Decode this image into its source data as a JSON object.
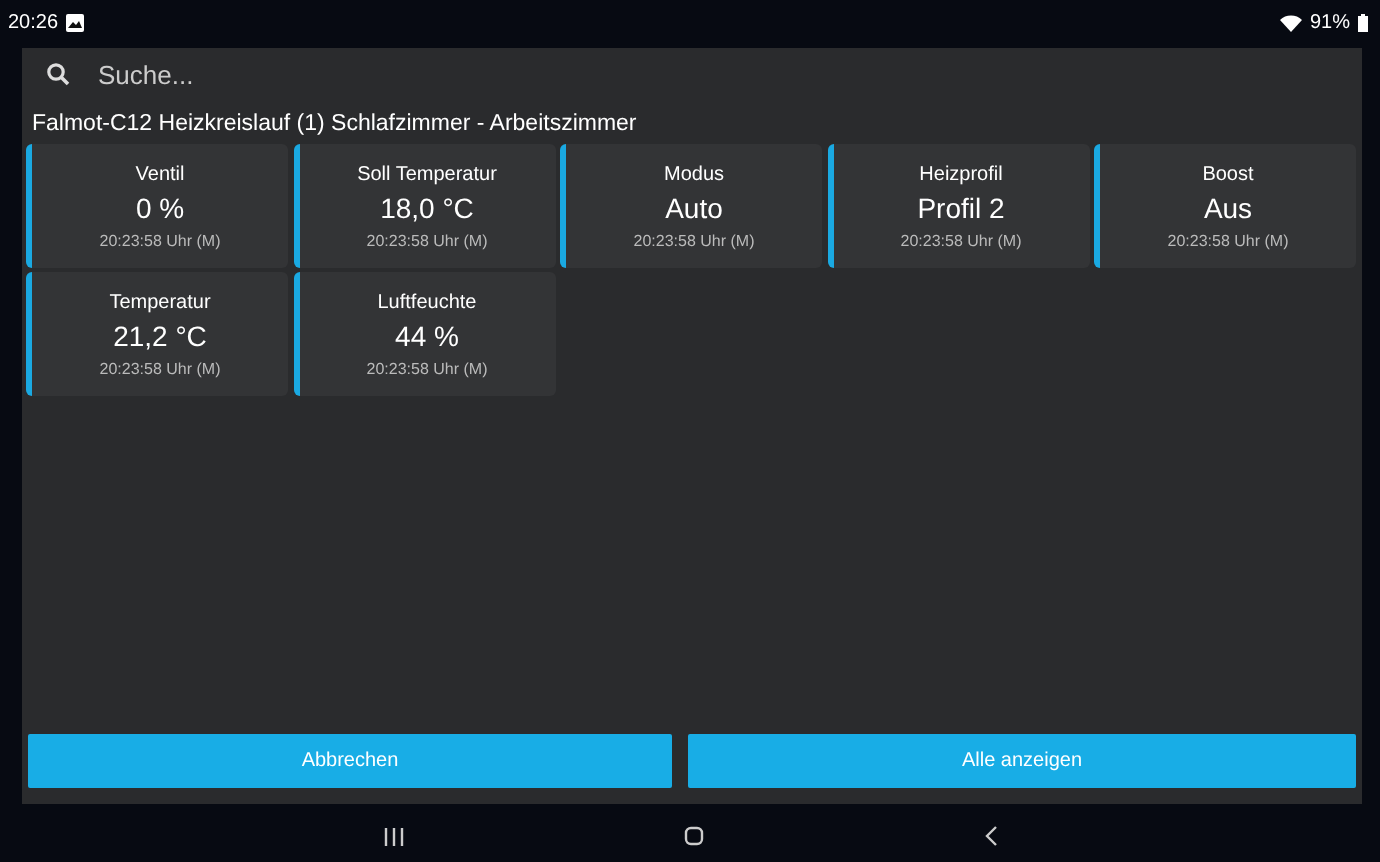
{
  "status_bar": {
    "time": "20:26",
    "battery": "91%"
  },
  "search": {
    "placeholder": "Suche..."
  },
  "dialog": {
    "title": "Falmot-C12 Heizkreislauf (1) Schlafzimmer - Arbeitszimmer",
    "tiles": [
      {
        "label": "Ventil",
        "value": "0 %",
        "time": "20:23:58 Uhr (M)"
      },
      {
        "label": "Soll Temperatur",
        "value": "18,0 °C",
        "time": "20:23:58 Uhr (M)"
      },
      {
        "label": "Modus",
        "value": "Auto",
        "time": "20:23:58 Uhr (M)"
      },
      {
        "label": "Heizprofil",
        "value": "Profil 2",
        "time": "20:23:58 Uhr (M)"
      },
      {
        "label": "Boost",
        "value": "Aus",
        "time": "20:23:58 Uhr (M)"
      },
      {
        "label": "Temperatur",
        "value": "21,2 °C",
        "time": "20:23:58 Uhr (M)"
      },
      {
        "label": "Luftfeuchte",
        "value": "44 %",
        "time": "20:23:58 Uhr (M)"
      }
    ],
    "buttons": [
      "Abbrechen",
      "Alle anzeigen"
    ]
  }
}
